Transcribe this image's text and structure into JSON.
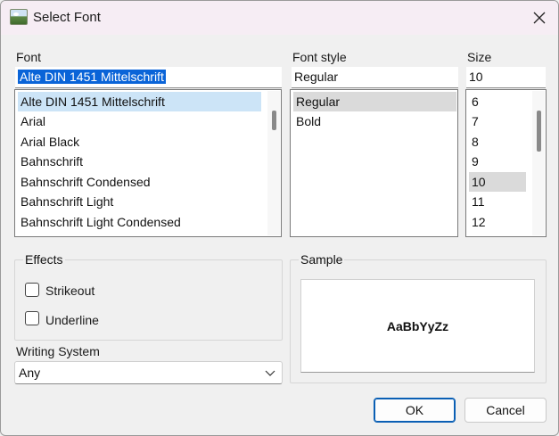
{
  "window": {
    "title": "Select Font",
    "icon": "image-icon",
    "close_icon": "close-icon"
  },
  "font": {
    "label": "Font",
    "value": "Alte DIN 1451 Mittelschrift",
    "items": [
      "Alte DIN 1451 Mittelschrift",
      "Arial",
      "Arial Black",
      "Bahnschrift",
      "Bahnschrift Condensed",
      "Bahnschrift Light",
      "Bahnschrift Light Condensed"
    ],
    "selected_index": 0
  },
  "style": {
    "label": "Font style",
    "value": "Regular",
    "items": [
      "Regular",
      "Bold"
    ],
    "selected_index": 0
  },
  "size": {
    "label": "Size",
    "value": "10",
    "items": [
      "6",
      "7",
      "8",
      "9",
      "10",
      "11",
      "12"
    ],
    "selected_index": 4
  },
  "effects": {
    "label": "Effects",
    "strikeout_label": "Strikeout",
    "strikeout_checked": false,
    "underline_label": "Underline",
    "underline_checked": false
  },
  "writing_system": {
    "label": "Writing System",
    "value": "Any"
  },
  "sample": {
    "label": "Sample",
    "text": "AaBbYyZz"
  },
  "buttons": {
    "ok": "OK",
    "cancel": "Cancel"
  },
  "colors": {
    "selection": "#0a64d8",
    "list_highlight": "#cce4f7",
    "default_button_border": "#0a5fb4"
  }
}
